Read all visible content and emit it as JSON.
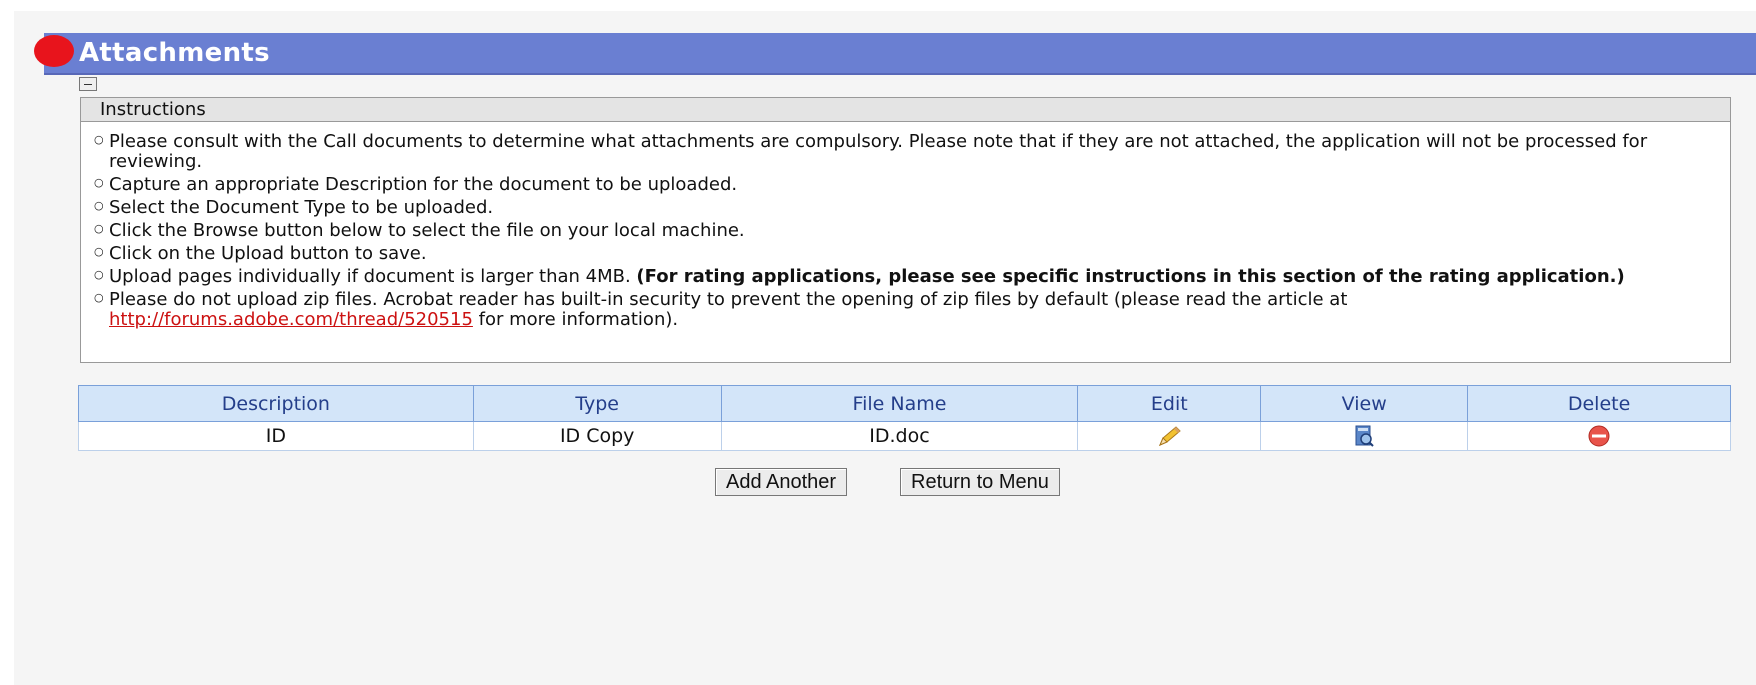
{
  "section": {
    "title": "Attachments"
  },
  "instructions": {
    "heading": "Instructions",
    "items": [
      {
        "text": "Please consult with the Call documents to determine what attachments are compulsory. Please note that if they are not attached, the application will not be processed for reviewing."
      },
      {
        "text": "Capture an appropriate Description for the document to be uploaded."
      },
      {
        "text": "Select the Document Type to be uploaded."
      },
      {
        "text": "Click the Browse button below to select the file on your local machine."
      },
      {
        "text": "Click on the Upload button to save."
      },
      {
        "text": "Upload pages individually if document is larger than 4MB. ",
        "bold": "(For rating applications, please see specific instructions in this section of the rating application.)"
      },
      {
        "text": "Please do not upload zip files. Acrobat reader has built-in security to prevent the opening of zip files by default (please read the article at ",
        "link": "http://forums.adobe.com/thread/520515",
        "after": " for more information)."
      }
    ]
  },
  "table": {
    "columns": [
      "Description",
      "Type",
      "File Name",
      "Edit",
      "View",
      "Delete"
    ],
    "rows": [
      {
        "description": "ID",
        "type": "ID Copy",
        "file_name": "ID.doc",
        "edit_icon": "pencil-icon",
        "view_icon": "document-view-icon",
        "delete_icon": "delete-icon"
      }
    ]
  },
  "buttons": {
    "add_another": "Add Another",
    "return_to_menu": "Return to Menu"
  },
  "colors": {
    "title_bar": "#6a7fd2",
    "title_dot": "#e8141c",
    "table_header_bg": "#d3e5f9",
    "table_header_text": "#243e8a",
    "link": "#cc1111"
  }
}
